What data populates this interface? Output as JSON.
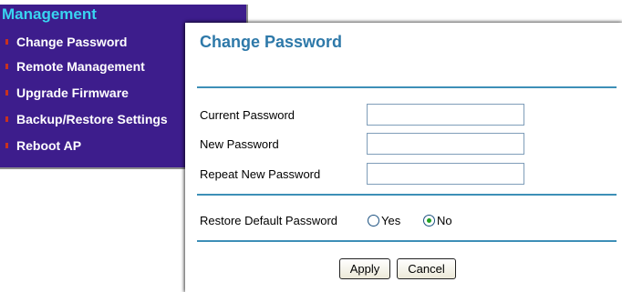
{
  "menu": {
    "title": "Management",
    "items": [
      {
        "label": "Change Password"
      },
      {
        "label": "Remote Management"
      },
      {
        "label": "Upgrade Firmware"
      },
      {
        "label": "Backup/Restore Settings"
      },
      {
        "label": "Reboot AP"
      }
    ]
  },
  "dialog": {
    "title": "Change Password",
    "fields": {
      "current_password": {
        "label": "Current Password",
        "value": ""
      },
      "new_password": {
        "label": "New Password",
        "value": ""
      },
      "repeat_new_password": {
        "label": "Repeat New Password",
        "value": ""
      }
    },
    "restore_default": {
      "label": "Restore Default Password",
      "options": [
        {
          "label": "Yes",
          "selected": false
        },
        {
          "label": "No",
          "selected": true
        }
      ]
    },
    "buttons": {
      "apply": "Apply",
      "cancel": "Cancel"
    }
  },
  "colors": {
    "menu_bg": "#3d1d8c",
    "menu_title": "#38d4f0",
    "menu_bullet": "#c8321e",
    "panel_title": "#2e79a9",
    "rule": "#3d8fb7",
    "radio_selected": "#21a121"
  }
}
